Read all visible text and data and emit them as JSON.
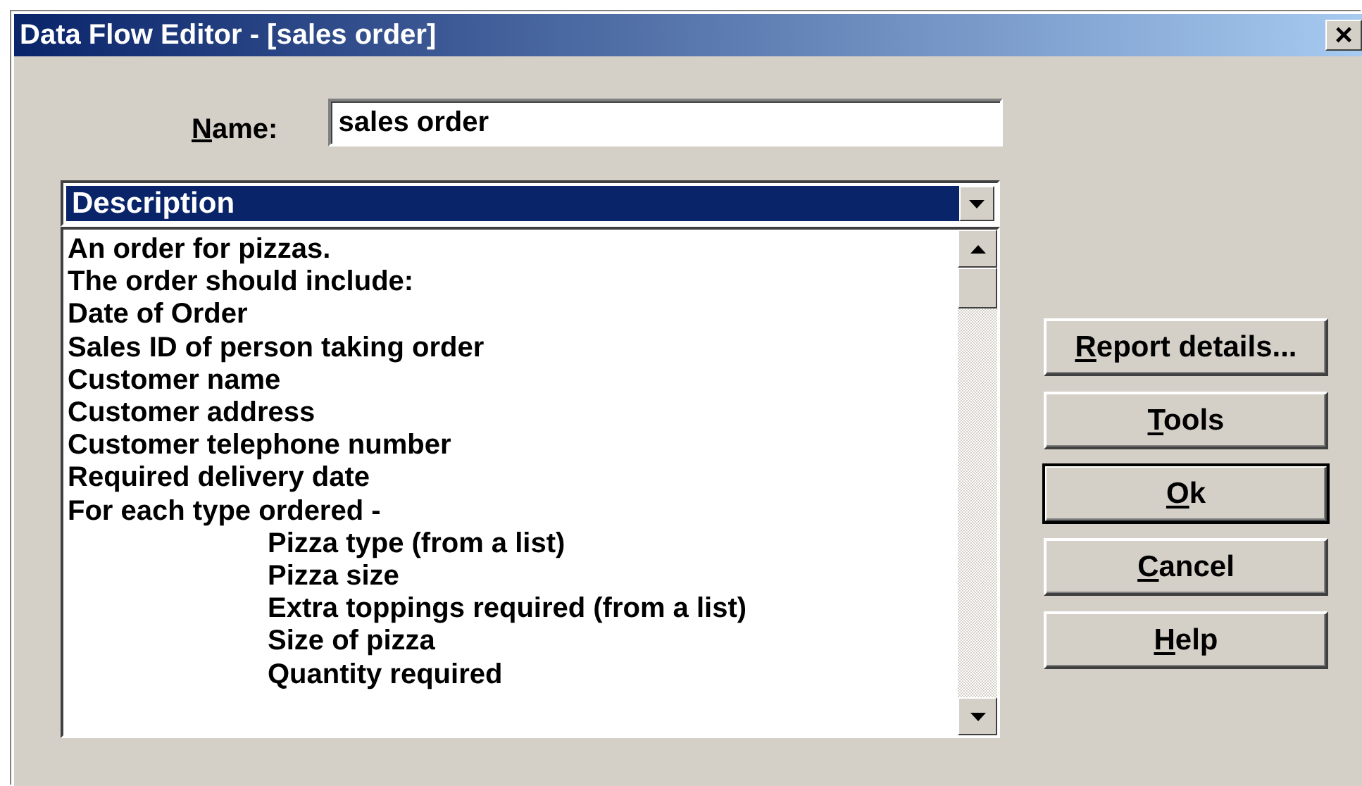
{
  "window": {
    "title": "Data Flow Editor - [sales order]",
    "close": "×"
  },
  "name_field": {
    "label": "Name:",
    "mnemonic_underlined": true,
    "value": "sales order"
  },
  "section_dropdown": {
    "value": "Description"
  },
  "description_lines": [
    {
      "text": "An order for pizzas."
    },
    {
      "text": "The order should include:"
    },
    {
      "text": "Date of Order"
    },
    {
      "text": "Sales ID of person taking order"
    },
    {
      "text": "Customer name"
    },
    {
      "text": "Customer address"
    },
    {
      "text": "Customer telephone number"
    },
    {
      "text": "Required delivery date"
    },
    {
      "text": "For each type ordered -",
      "children": [
        {
          "text": "Pizza type (from a list)"
        },
        {
          "text": "Pizza size"
        },
        {
          "text": "Extra toppings required (from a list)"
        },
        {
          "text": "Size of pizza"
        },
        {
          "text": "Quantity required"
        }
      ]
    }
  ],
  "buttons": [
    {
      "label": "Report details...",
      "mnemonic_underlined": true,
      "default": false
    },
    {
      "label": "Tools",
      "mnemonic_underlined": true,
      "default": false
    },
    {
      "label": "Ok",
      "mnemonic_underlined": true,
      "default": true
    },
    {
      "label": "Cancel",
      "mnemonic_underlined": true,
      "default": false
    },
    {
      "label": "Help",
      "mnemonic_underlined": true,
      "default": false
    }
  ]
}
